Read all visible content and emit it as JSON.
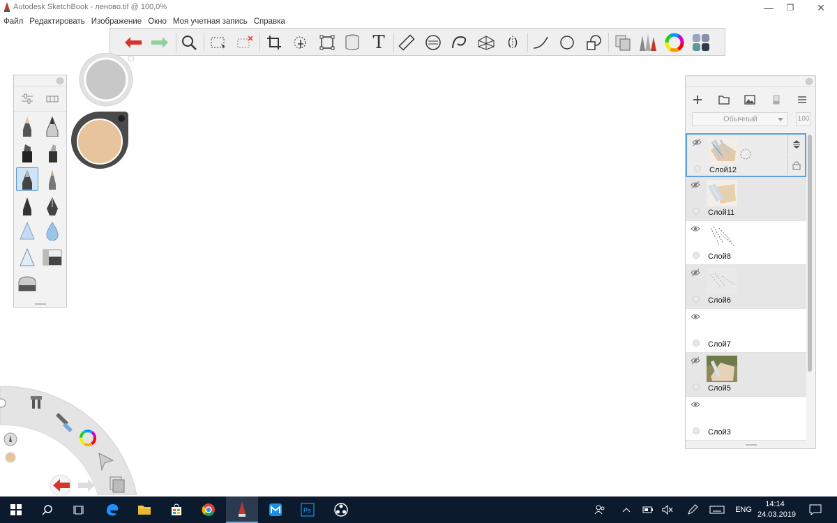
{
  "window": {
    "title": "Autodesk SketchBook - леново.tif @ 100,0%",
    "minimize_label": "—",
    "restore_label": "❐",
    "close_label": "✕"
  },
  "menu": [
    "Файл",
    "Редактировать",
    "Изображение",
    "Окно",
    "Моя учетная запись",
    "Справка"
  ],
  "toolbar": {
    "tools": [
      "undo-icon",
      "redo-icon",
      "zoom-icon",
      "select-icon",
      "deselect-icon",
      "crop-icon",
      "transform-icon",
      "distort-icon",
      "fill-icon",
      "text-icon",
      "ruler-icon",
      "ellipse-guide-icon",
      "french-curve-icon",
      "perspective-icon",
      "symmetry-icon",
      "stroke-icon",
      "circle-icon",
      "shape-icon",
      "copy-icon",
      "brush-library-icon",
      "color-wheel-icon",
      "color-swatches-icon"
    ],
    "text_tool_glyph": "T"
  },
  "colors": {
    "puck_color": "#e8c49c",
    "accent_blue": "#5aa0e0",
    "undo_red": "#d9322b",
    "redo_green": "#7ec98a",
    "taskbar": "#0c1a2e"
  },
  "brush_palette": {
    "brushes": [
      "pencil-brush",
      "ballpoint-brush",
      "marker-brush",
      "chisel-marker-brush",
      "pen-brush",
      "fine-pen-brush",
      "ink-brush",
      "fountain-pen-brush",
      "airbrush-brush",
      "water-drop-brush",
      "soft-airbrush-brush",
      "smudge-brush",
      "eraser-brush"
    ],
    "selected": "pen-brush"
  },
  "layers": {
    "blend_mode": "Обычный",
    "opacity": "100",
    "items": [
      {
        "name": "Слой12",
        "visible": false,
        "selected": true
      },
      {
        "name": "Слой11",
        "visible": false,
        "selected": false
      },
      {
        "name": "Слой8",
        "visible": true,
        "selected": false
      },
      {
        "name": "Слой6",
        "visible": false,
        "selected": false
      },
      {
        "name": "Слой7",
        "visible": true,
        "selected": false
      },
      {
        "name": "Слой5",
        "visible": false,
        "selected": false
      },
      {
        "name": "Слой3",
        "visible": true,
        "selected": false
      }
    ]
  },
  "taskbar": {
    "items": [
      "windows-start",
      "search",
      "task-view",
      "edge",
      "file-explorer",
      "store",
      "chrome",
      "sketchbook",
      "maxthon",
      "photoshop",
      "obs"
    ],
    "language": "ENG",
    "time": "14:14",
    "date": "24.03.2019"
  }
}
